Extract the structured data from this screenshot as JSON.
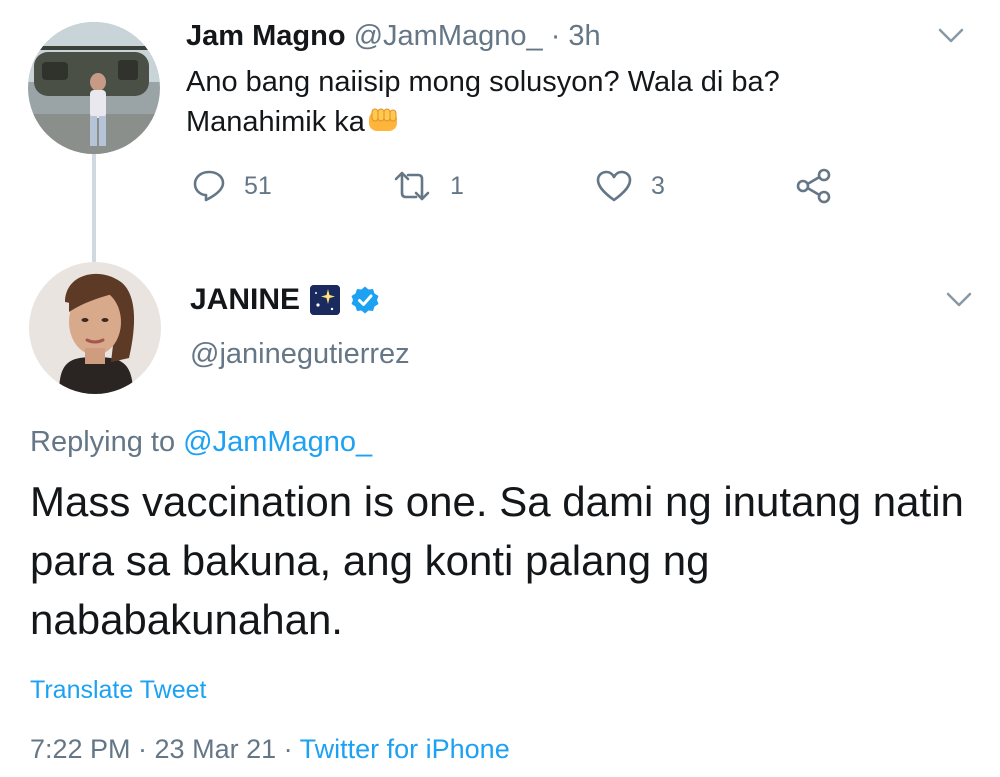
{
  "reply_tweet": {
    "name": "Jam Magno",
    "handle": "@JamMagno_",
    "separator": "·",
    "time": "3h",
    "text_line1": "Ano bang naiisip mong solusyon? Wala di ba?",
    "text_line2": "Manahimik ka",
    "emoji": "fist-emoji",
    "counts": {
      "replies": "51",
      "retweets": "1",
      "likes": "3"
    }
  },
  "main_tweet": {
    "name": "JANINE",
    "name_emoji": "sparkle-night-emoji",
    "verified_icon": "verified-badge-icon",
    "handle": "@janinegutierrez",
    "replying_label": "Replying to ",
    "replying_handle": "@JamMagno_",
    "text": "Mass vaccination is one. Sa dami ng inutang natin para sa bakuna, ang konti palang ng nababakunahan.",
    "translate": "Translate Tweet",
    "timestamp": "7:22 PM · 23 Mar 21 · ",
    "source": "Twitter for iPhone"
  },
  "icons": [
    "reply-icon",
    "retweet-icon",
    "like-icon",
    "share-icon",
    "chevron-down-icon"
  ],
  "colors": {
    "accent": "#1da1f2",
    "muted": "#657786",
    "text": "#14171a",
    "thread_line": "#cfd9de"
  }
}
